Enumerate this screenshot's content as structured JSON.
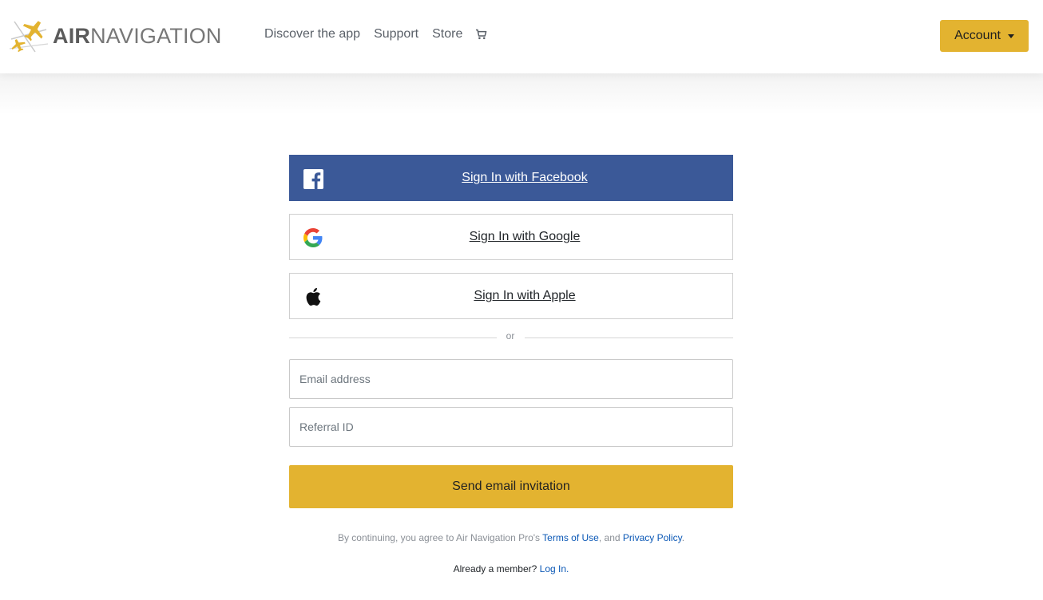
{
  "header": {
    "logo": {
      "part1": "AIR",
      "part2": "NAVIGATION"
    },
    "nav": [
      {
        "label": "Discover the app"
      },
      {
        "label": "Support"
      },
      {
        "label": "Store"
      }
    ],
    "cart_icon": "shopping-cart-icon",
    "account_label": "Account"
  },
  "signin": {
    "facebook_label": "Sign In with Facebook",
    "google_label": "Sign In with Google",
    "apple_label": "Sign In with Apple",
    "divider": "or",
    "email_placeholder": "Email address",
    "email_value": "",
    "referral_placeholder": "Referral ID",
    "referral_value": "",
    "send_label": "Send email invitation"
  },
  "footer": {
    "legal_prefix": "By continuing, you agree to Air Navigation Pro's",
    "terms_label": "Terms of Use",
    "legal_and": ", and",
    "privacy_label": "Privacy Policy",
    "legal_end": ".",
    "member_prefix": "Already a member?",
    "login_label": "Log In."
  },
  "colors": {
    "accent": "#e3b330",
    "facebook": "#3b5998",
    "link": "#0b58b6"
  }
}
